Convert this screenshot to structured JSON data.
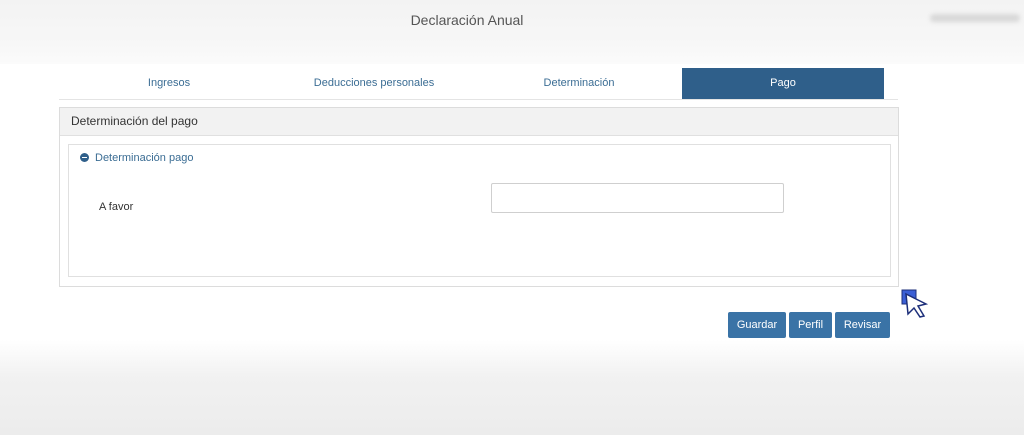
{
  "header": {
    "title": "Declaración Anual"
  },
  "tabs": [
    {
      "label": "Ingresos",
      "active": false
    },
    {
      "label": "Deducciones personales",
      "active": false
    },
    {
      "label": "Determinación",
      "active": false
    },
    {
      "label": "Pago",
      "active": true
    }
  ],
  "panel": {
    "title": "Determinación del pago",
    "section": {
      "title": "Determinación pago",
      "expand_icon": "minus-circle-icon",
      "field": {
        "label": "A favor",
        "value": ""
      }
    }
  },
  "actions": {
    "save_label": "Guardar",
    "profile_label": "Perfil",
    "review_label": "Revisar"
  },
  "colors": {
    "accent": "#2f5f8a",
    "button": "#3a73a6",
    "tab_text": "#3b6d94"
  }
}
